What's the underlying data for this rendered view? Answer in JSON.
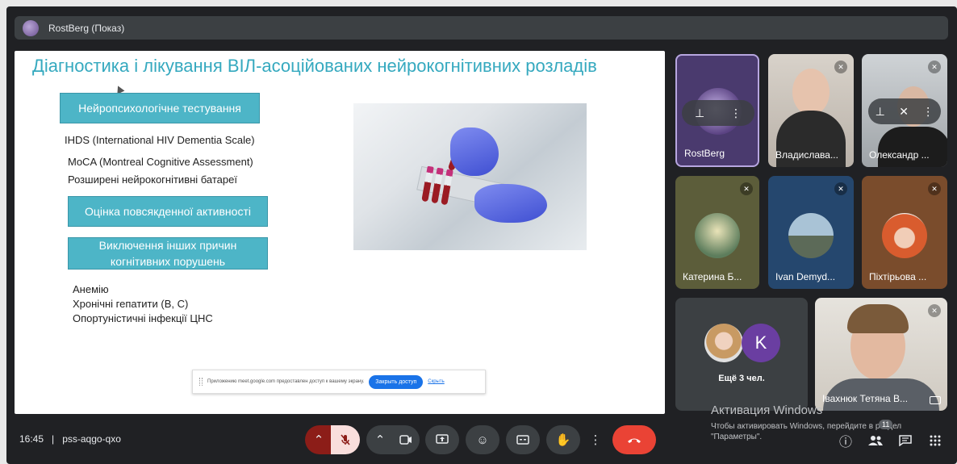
{
  "topbar": {
    "title": "RostBerg (Показ)"
  },
  "slide": {
    "title": "Діагностика і лікування ВІЛ-асоційованих нейрокогнітивних розладів",
    "pill1": "Нейропсихологічне тестування",
    "item1": "IHDS (International HIV Dementia Scale)",
    "item2": "MoCA (Montreal Cognitive Assessment)",
    "item3": "Розширені нейрокогнітивні батареї",
    "pill2": "Оцінка повсякденної активності",
    "pill3_line1": "Виключення інших причин",
    "pill3_line2": "когнітивних порушень",
    "item4": "Анемію",
    "item5": "Хронічні гепатити (В, С)",
    "item6": "Опортуністичні інфекції ЦНС"
  },
  "share_bar": {
    "message": "Приложению meet.google.com предоставлен доступ к вашему экрану.",
    "stop_label": "Закрыть доступ",
    "hide_label": "Скрыть"
  },
  "participants": [
    {
      "name": "RostBerg",
      "muted": false
    },
    {
      "name": "Владислава...",
      "muted": true
    },
    {
      "name": "Олександр ...",
      "muted": true
    },
    {
      "name": "Катерина Б...",
      "muted": true
    },
    {
      "name": "Ivan Demyd...",
      "muted": true
    },
    {
      "name": "Піхтірьова ...",
      "muted": true
    },
    {
      "name": "Іваxнюк Тетяна В...",
      "muted": true
    }
  ],
  "others": {
    "label": "Ещё 3 чел.",
    "avatar_letter": "K"
  },
  "bottom": {
    "time": "16:45",
    "separator": "|",
    "meeting_code": "pss-aqgo-qxo",
    "participants_count": "11"
  },
  "watermark": {
    "line1": "Активация Windows",
    "line2": "Чтобы активировать Windows, перейдите в раздел",
    "line3": "\"Параметры\"."
  },
  "icons": [
    "mic-off-icon",
    "chevron-up-icon",
    "camera-icon",
    "present-icon",
    "emoji-icon",
    "captions-icon",
    "raise-hand-icon",
    "more-vert-icon",
    "end-call-icon",
    "info-icon",
    "people-icon",
    "chat-icon",
    "activities-icon",
    "pin-icon"
  ],
  "colors": {
    "accent": "#35a9bf",
    "pill": "#4db5c7",
    "end_call": "#ea4335",
    "bg": "#202124"
  }
}
